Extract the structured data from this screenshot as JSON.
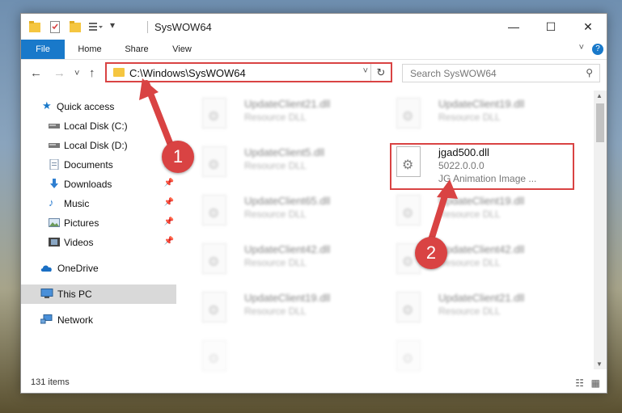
{
  "window": {
    "title": "SysWOW64",
    "controls": {
      "minimize": "—",
      "maximize": "☐",
      "close": "✕"
    }
  },
  "ribbon": {
    "tabs": [
      "File",
      "Home",
      "Share",
      "View"
    ],
    "expand": "˅",
    "help": "?"
  },
  "nav": {
    "back": "←",
    "forward": "→",
    "recent": "˅",
    "up": "↑",
    "address": "C:\\Windows\\SysWOW64",
    "search_placeholder": "Search SysWOW64"
  },
  "sidebar": {
    "items": [
      {
        "label": "Quick access",
        "icon": "star-icon"
      },
      {
        "label": "Local Disk (C:)",
        "icon": "drive-icon"
      },
      {
        "label": "Local Disk (D:)",
        "icon": "drive-icon"
      },
      {
        "label": "Documents",
        "icon": "documents-icon"
      },
      {
        "label": "Downloads",
        "icon": "download-icon"
      },
      {
        "label": "Music",
        "icon": "music-icon"
      },
      {
        "label": "Pictures",
        "icon": "pictures-icon"
      },
      {
        "label": "Videos",
        "icon": "videos-icon"
      },
      {
        "label": "OneDrive",
        "icon": "cloud-icon"
      },
      {
        "label": "This PC",
        "icon": "computer-icon"
      },
      {
        "label": "Network",
        "icon": "network-icon"
      }
    ]
  },
  "files": [
    {
      "name": "UpdateClient21.dll",
      "desc": "Resource DLL"
    },
    {
      "name": "UpdateClient19.dll",
      "desc": "Resource DLL"
    },
    {
      "name": "UpdateClient5.dll",
      "desc": "Resource DLL"
    },
    {
      "name": "jgad500.dll",
      "version": "5022.0.0.0",
      "desc": "JG Animation Image ..."
    },
    {
      "name": "UpdateClient65.dll",
      "desc": "Resource DLL"
    },
    {
      "name": "UpdateClient19.dll",
      "desc": "Resource DLL"
    },
    {
      "name": "UpdateClient42.dll",
      "desc": "Resource DLL"
    },
    {
      "name": "UpdateClient42.dll",
      "desc": "Resource DLL"
    },
    {
      "name": "UpdateClient19.dll",
      "desc": "Resource DLL"
    },
    {
      "name": "UpdateClient21.dll",
      "desc": "Resource DLL"
    }
  ],
  "status": {
    "count": "131 items"
  },
  "callouts": [
    "1",
    "2"
  ],
  "colors": {
    "accent": "#1979ca",
    "highlight": "#d94343"
  }
}
